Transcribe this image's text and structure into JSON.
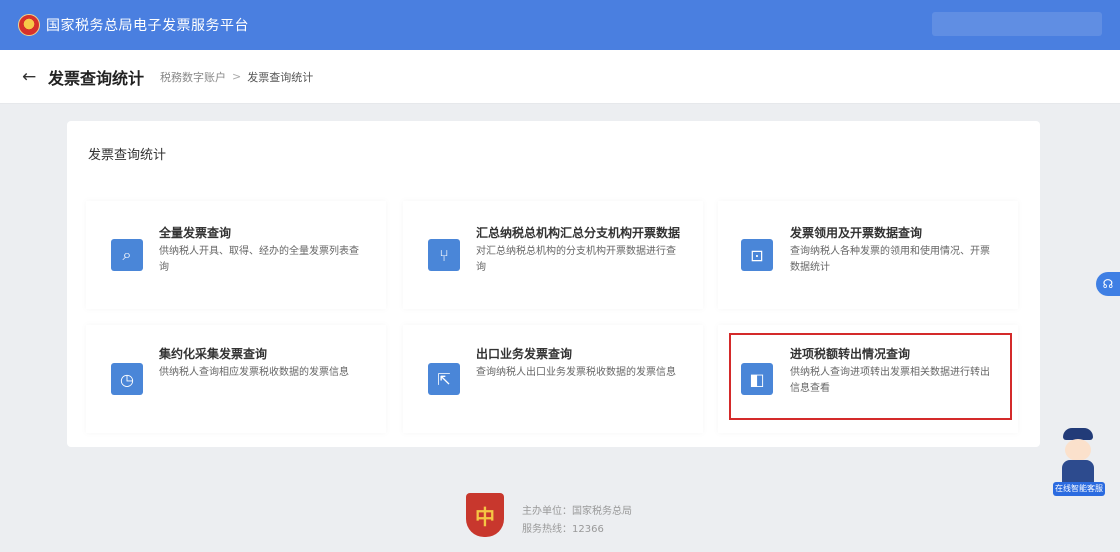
{
  "header": {
    "site_title": "国家税务总局电子发票服务平台",
    "logo_icon": "tax-emblem-icon"
  },
  "breadcrumb_bar": {
    "back_icon": "back-arrow-icon",
    "page_title": "发票查询统计",
    "crumbs": [
      "税務数字账户",
      "发票查询统计"
    ]
  },
  "panel": {
    "title": "发票查询统计",
    "cards": [
      {
        "title": "全量发票查询",
        "description": "供纳税人开具、取得、经办的全量发票列表查询",
        "icon": "search-doc-icon"
      },
      {
        "title": "汇总纳税总机构汇总分支机构开票数据",
        "description": "对汇总纳税总机构的分支机构开票数据进行查询",
        "icon": "branch-icon"
      },
      {
        "title": "发票领用及开票数据查询",
        "description": "查询纳税人各种发票的领用和使用情况、开票数据统计",
        "icon": "chart-doc-icon"
      },
      {
        "title": "集约化采集发票查询",
        "description": "供纳税人查询相应发票税收数据的发票信息",
        "icon": "clock-doc-icon"
      },
      {
        "title": "出口业务发票查询",
        "description": "查询纳税人出口业务发票税收数据的发票信息",
        "icon": "export-doc-icon"
      },
      {
        "title": "进项税额转出情况查询",
        "description": "供纳税人查询进项转出发票相关数据进行转出信息查看",
        "icon": "transfer-doc-icon"
      }
    ]
  },
  "footer": {
    "emblem_icon": "tax-shield-icon",
    "line1": "主办单位：国家税务总局",
    "line2": "服务热线：12366"
  },
  "side": {
    "support_icon": "headset-icon",
    "assistant_label": "在线智能客服"
  }
}
